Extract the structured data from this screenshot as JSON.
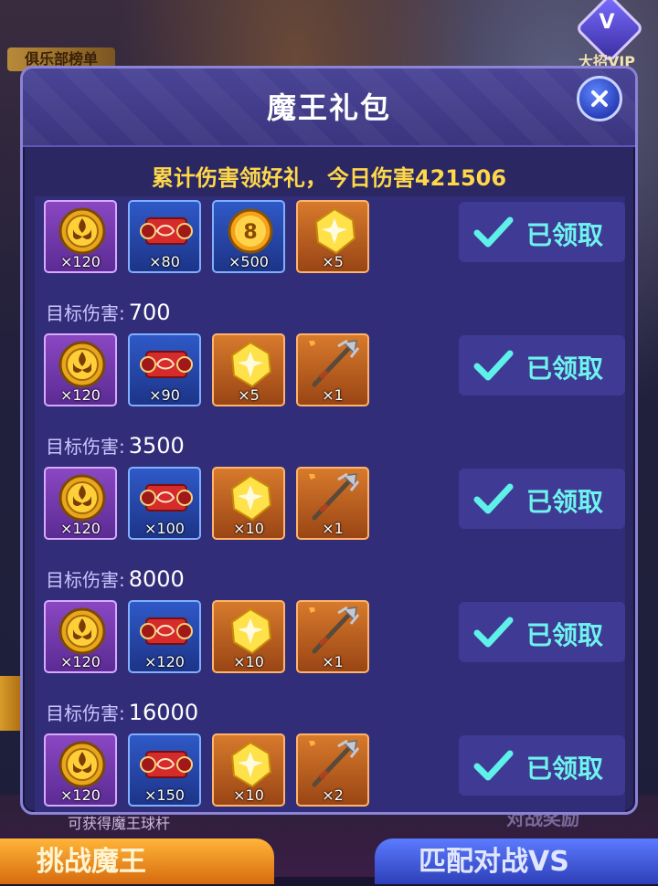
{
  "background": {
    "banner": "俱乐部榜单",
    "vip_label": "大招VIP",
    "vip_badge": "V",
    "hint": "可获得魔王球杆",
    "reward_text": "对战奖励",
    "left_button": "挑战魔王",
    "right_button": "匹配对战VS"
  },
  "modal": {
    "title": "魔王礼包",
    "subtitle": "累计伤害领好礼，今日伤害421506",
    "close_icon": "close-icon",
    "target_label": "目标伤害:",
    "claimed_label": "已领取",
    "rows": [
      {
        "target": "",
        "items": [
          {
            "type": "emblem",
            "qty": "×120",
            "frame": "purple"
          },
          {
            "type": "scroll",
            "qty": "×80",
            "frame": "blue"
          },
          {
            "type": "coin-8",
            "qty": "×500",
            "frame": "blue"
          },
          {
            "type": "gem",
            "qty": "×5",
            "frame": "orange"
          }
        ],
        "status": "已领取"
      },
      {
        "target": "700",
        "items": [
          {
            "type": "emblem",
            "qty": "×120",
            "frame": "purple"
          },
          {
            "type": "scroll",
            "qty": "×90",
            "frame": "blue"
          },
          {
            "type": "gem",
            "qty": "×5",
            "frame": "orange"
          },
          {
            "type": "trident",
            "qty": "×1",
            "frame": "orange"
          }
        ],
        "status": "已领取"
      },
      {
        "target": "3500",
        "items": [
          {
            "type": "emblem",
            "qty": "×120",
            "frame": "purple"
          },
          {
            "type": "scroll",
            "qty": "×100",
            "frame": "blue"
          },
          {
            "type": "gem",
            "qty": "×10",
            "frame": "orange"
          },
          {
            "type": "trident",
            "qty": "×1",
            "frame": "orange"
          }
        ],
        "status": "已领取"
      },
      {
        "target": "8000",
        "items": [
          {
            "type": "emblem",
            "qty": "×120",
            "frame": "purple"
          },
          {
            "type": "scroll",
            "qty": "×120",
            "frame": "blue"
          },
          {
            "type": "gem",
            "qty": "×10",
            "frame": "orange"
          },
          {
            "type": "trident",
            "qty": "×1",
            "frame": "orange"
          }
        ],
        "status": "已领取"
      },
      {
        "target": "16000",
        "items": [
          {
            "type": "emblem",
            "qty": "×120",
            "frame": "purple"
          },
          {
            "type": "scroll",
            "qty": "×150",
            "frame": "blue"
          },
          {
            "type": "gem",
            "qty": "×10",
            "frame": "orange"
          },
          {
            "type": "trident",
            "qty": "×2",
            "frame": "orange"
          }
        ],
        "status": "已领取"
      }
    ]
  },
  "colors": {
    "accent_cyan": "#6ff3ee",
    "subtitle_gold": "#ffd84a",
    "panel_bg": "#2a2763"
  }
}
